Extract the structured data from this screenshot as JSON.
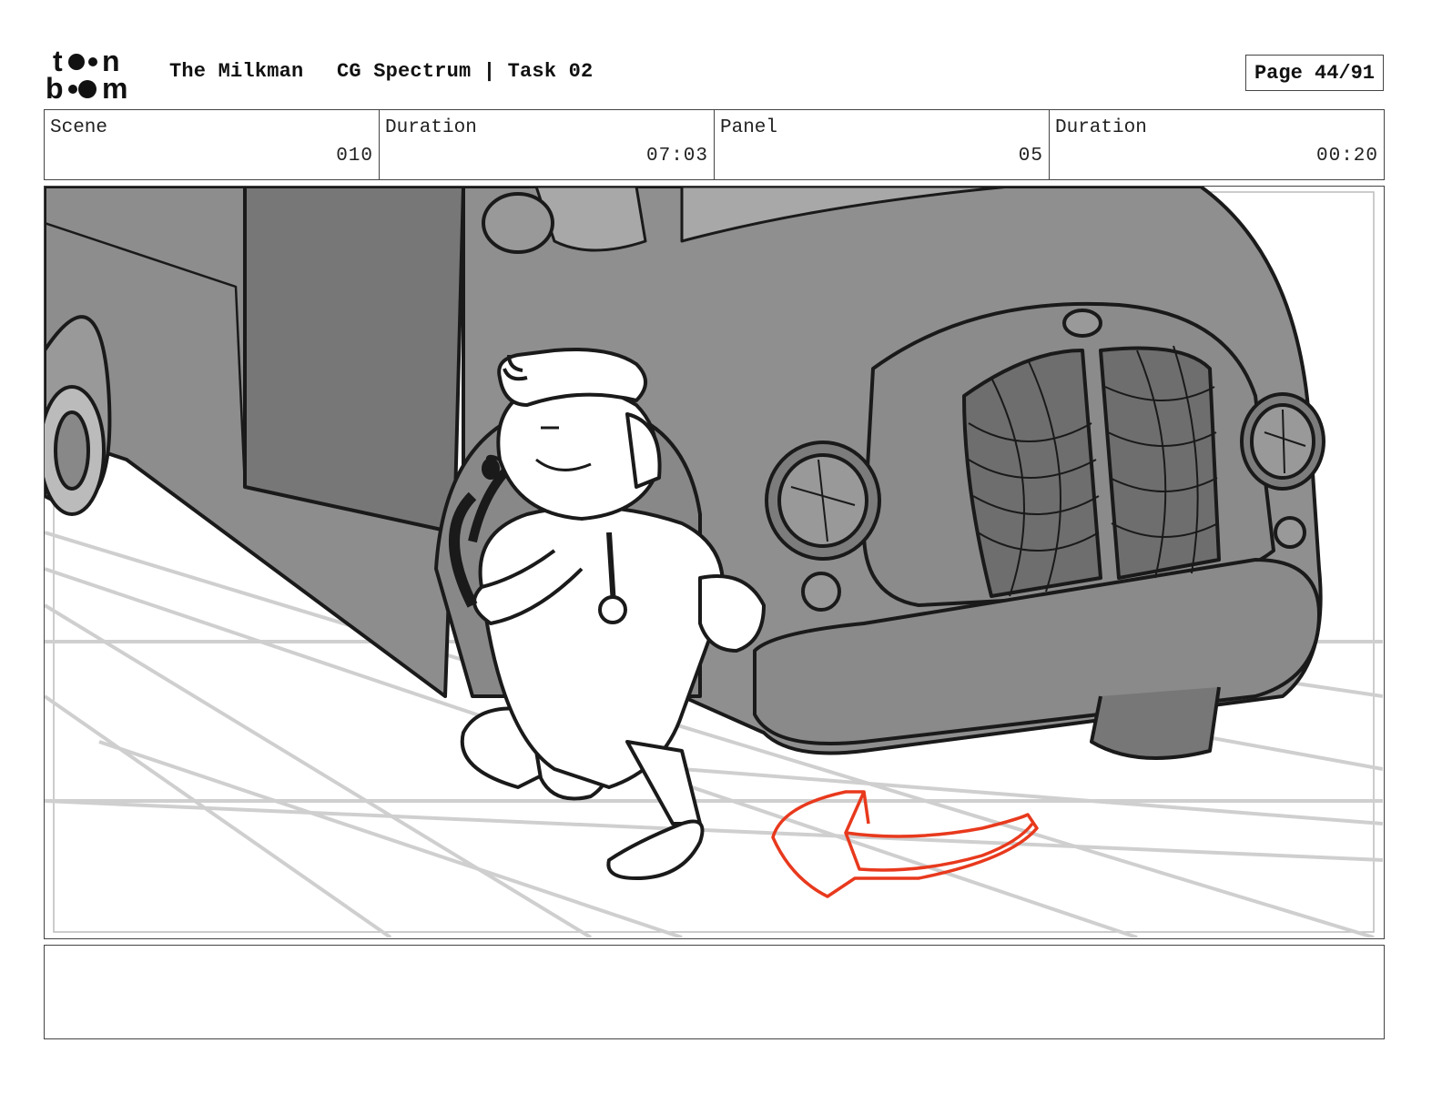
{
  "header": {
    "logo_text": "toon boom",
    "project_title": "The Milkman",
    "course_task": "CG Spectrum | Task 02",
    "page_label": "Page 44/91"
  },
  "info": {
    "scene": {
      "label": "Scene",
      "value": "010"
    },
    "scene_duration": {
      "label": "Duration",
      "value": "07:03"
    },
    "panel": {
      "label": "Panel",
      "value": "05"
    },
    "panel_duration": {
      "label": "Duration",
      "value": "00:20"
    }
  },
  "notes": {
    "text": ""
  },
  "colors": {
    "arrow": "#e8391d",
    "truck": "#8d8d8d",
    "ink": "#1a1a1a"
  }
}
